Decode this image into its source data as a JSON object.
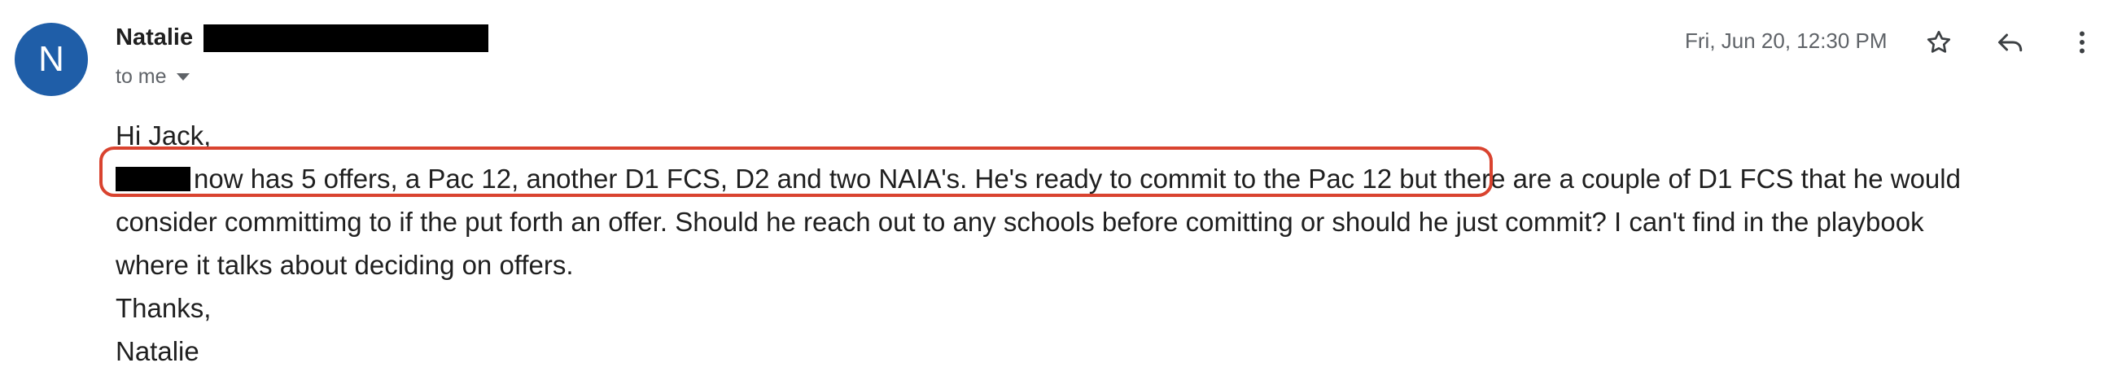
{
  "sender": {
    "avatar_initial": "N",
    "name": "Natalie",
    "recipient": "to me"
  },
  "header": {
    "date": "Fri, Jun 20, 12:30 PM",
    "icons": [
      "star-icon",
      "reply-icon",
      "more-vert-icon"
    ]
  },
  "message": {
    "greeting": "Hi Jack,",
    "line1_suffix": "now has 5 offers, a Pac 12, another D1 FCS, D2 and two NAIA's. He's ready to commit to the Pac 12 but there are a couple of D1 FCS that he would",
    "line2": "consider committimg to if the put forth an offer. Should he reach out to any schools before comitting or should he just commit? I can't find in the playbook",
    "line3": "where it talks about deciding on offers.",
    "closing": "Thanks,",
    "signature": "Natalie"
  },
  "colors": {
    "avatar_bg": "#1f5ea8",
    "highlight": "#d9432f",
    "secondary_text": "#5f6368"
  }
}
